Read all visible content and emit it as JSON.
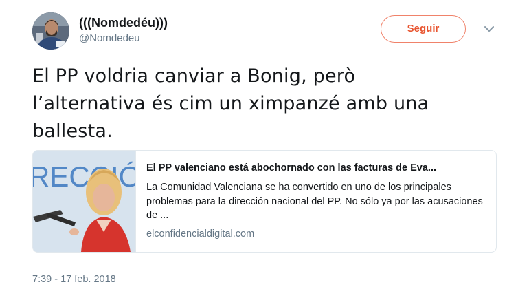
{
  "author": {
    "display_name": "(((Nomdedéu)))",
    "handle": "@Nomdedeu",
    "avatar_icon": "avatar-photo"
  },
  "follow_button": {
    "label": "Seguir",
    "color": "#e8542f"
  },
  "menu": {
    "icon": "chevron-down-icon"
  },
  "tweet": {
    "text_line1": "El PP voldria canviar a Bonig, però",
    "text_line2": "l’alternativa és cim un ximpanzé amb una",
    "text_line3": "ballesta."
  },
  "card": {
    "image_text": "RECCIÓ",
    "title": "El PP valenciano está abochornado con las facturas de Eva...",
    "description": "La Comunidad Valenciana se ha convertido en uno de los principales problemas para la dirección nacional del PP. No sólo ya por las acusaciones de ...",
    "domain": "elconfidencialdigital.com"
  },
  "timestamp": "7:39 - 17 feb. 2018"
}
